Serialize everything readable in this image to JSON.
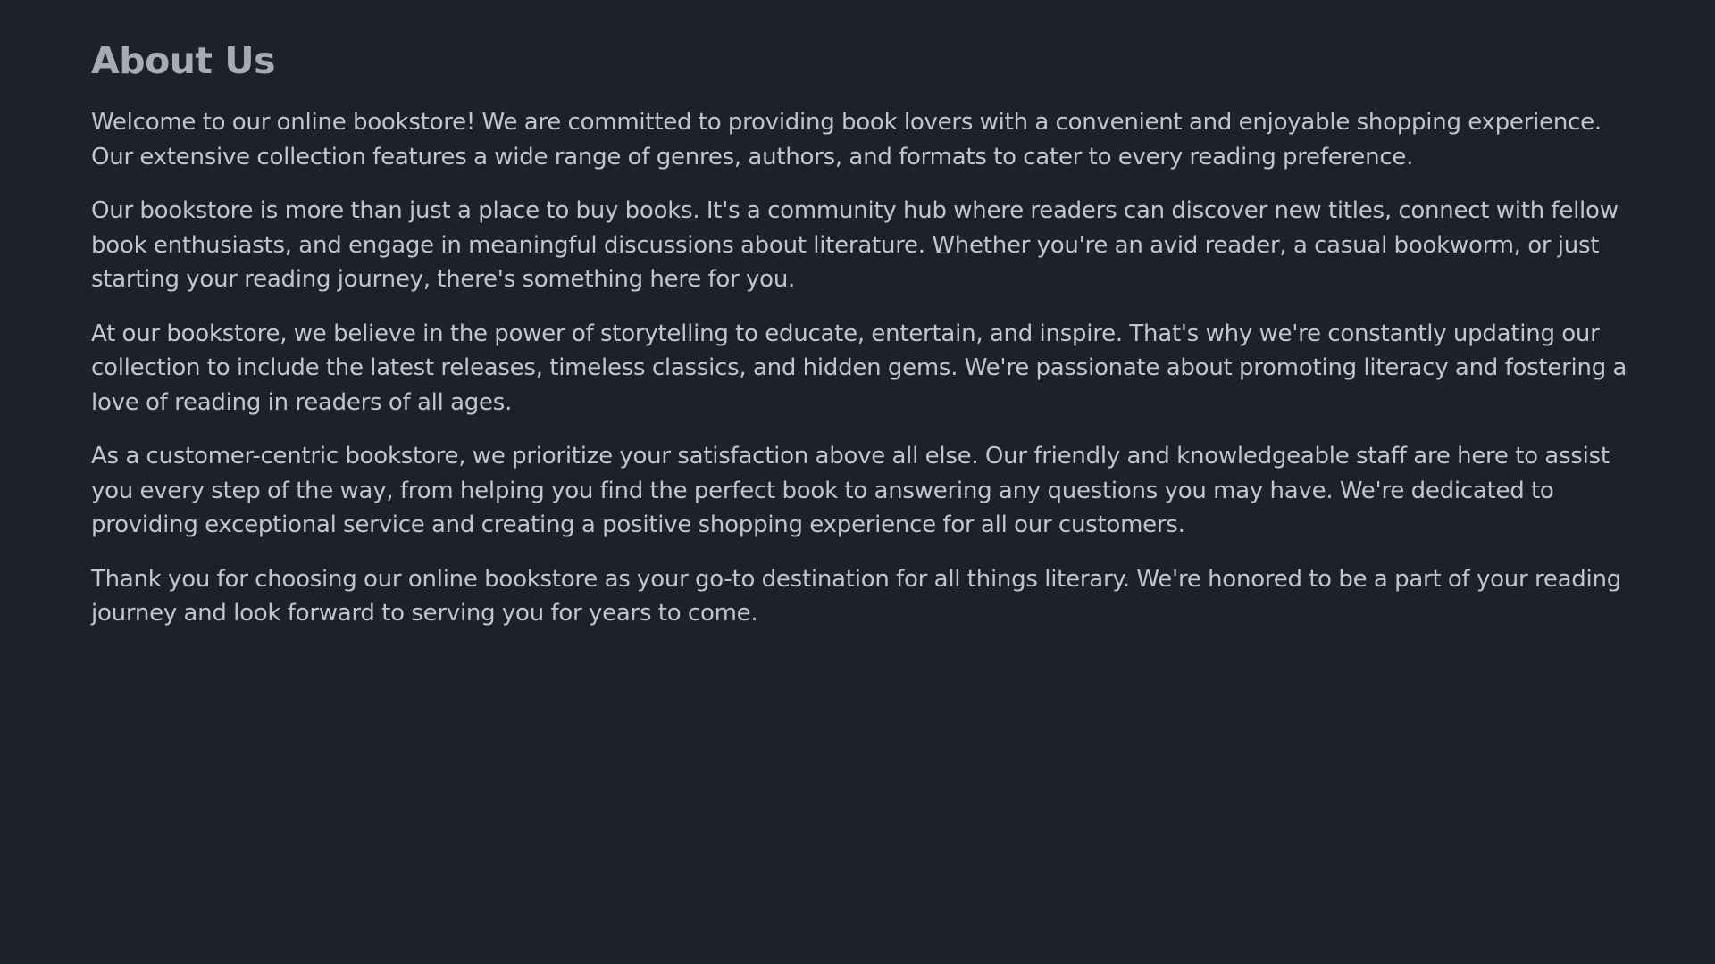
{
  "about": {
    "title": "About Us",
    "paragraphs": [
      "Welcome to our online bookstore! We are committed to providing book lovers with a convenient and enjoyable shopping experience. Our extensive collection features a wide range of genres, authors, and formats to cater to every reading preference.",
      "Our bookstore is more than just a place to buy books. It's a community hub where readers can discover new titles, connect with fellow book enthusiasts, and engage in meaningful discussions about literature. Whether you're an avid reader, a casual bookworm, or just starting your reading journey, there's something here for you.",
      "At our bookstore, we believe in the power of storytelling to educate, entertain, and inspire. That's why we're constantly updating our collection to include the latest releases, timeless classics, and hidden gems. We're passionate about promoting literacy and fostering a love of reading in readers of all ages.",
      "As a customer-centric bookstore, we prioritize your satisfaction above all else. Our friendly and knowledgeable staff are here to assist you every step of the way, from helping you find the perfect book to answering any questions you may have. We're dedicated to providing exceptional service and creating a positive shopping experience for all our customers.",
      "Thank you for choosing our online bookstore as your go-to destination for all things literary. We're honored to be a part of your reading journey and look forward to serving you for years to come."
    ]
  },
  "colors": {
    "background": "#1d222a",
    "title": "#a7abb2",
    "body_text": "#c2c6cc"
  }
}
